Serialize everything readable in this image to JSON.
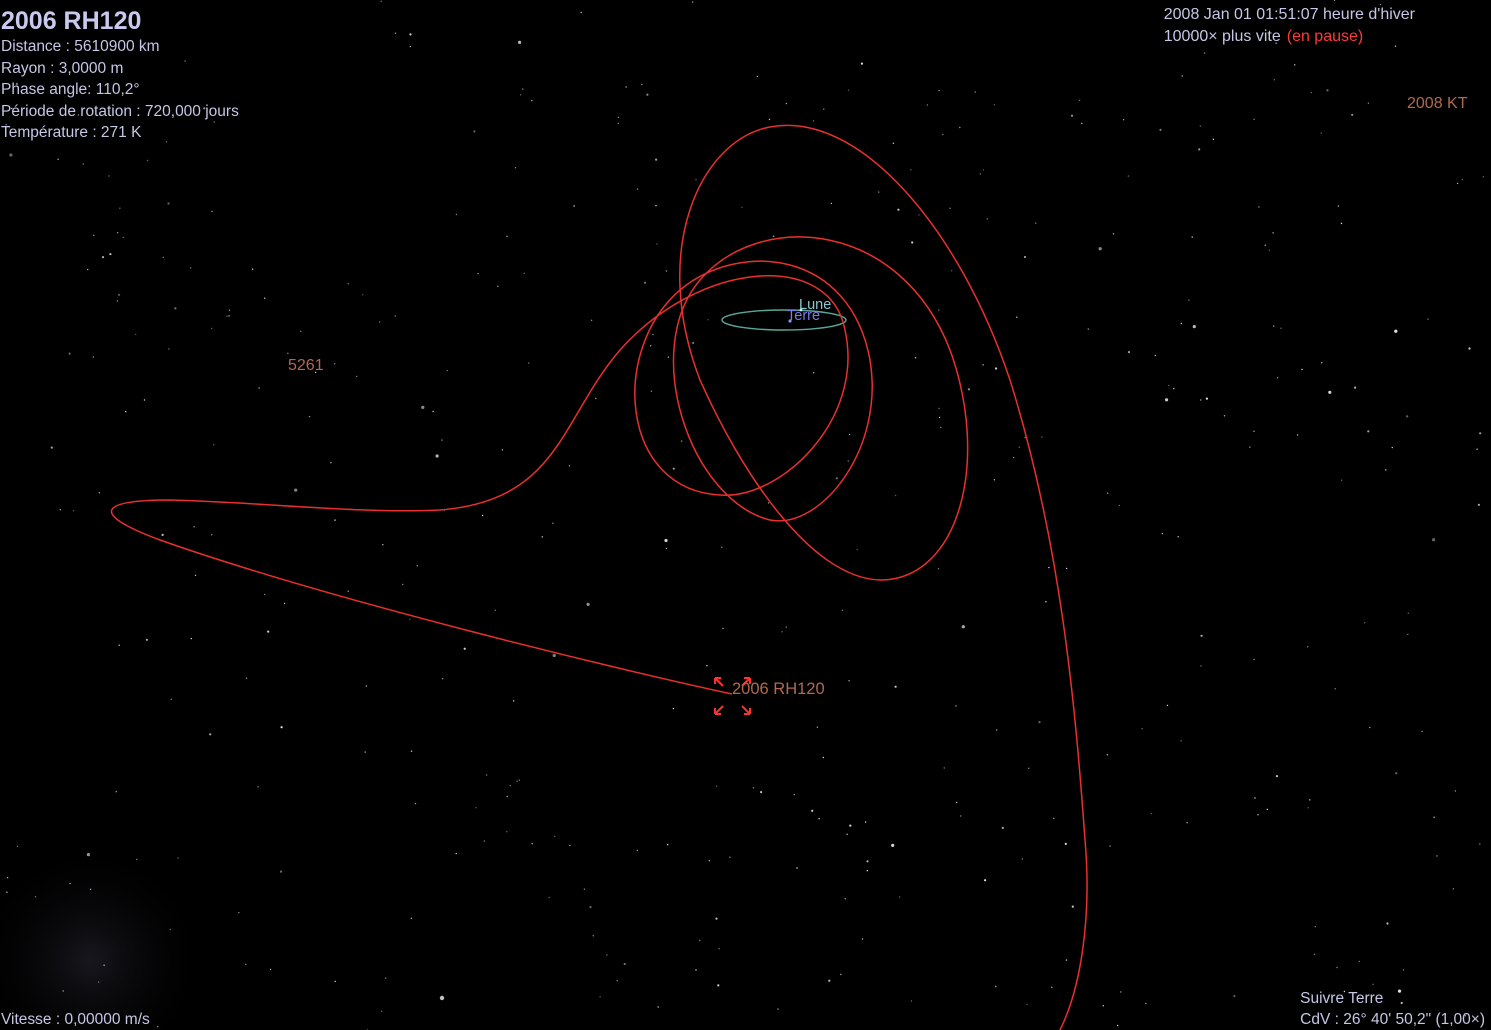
{
  "selection": {
    "name": "2006 RH120",
    "distance": "Distance : 5610900 km",
    "radius": "Rayon : 3,0000 m",
    "phase_angle": "Phase angle: 110,2°",
    "rotation_period": "Période de rotation : 720,000 jours",
    "temperature": "Température : 271 K"
  },
  "time": {
    "datetime": "2008 Jan 01 01:51:07 heure d'hiver",
    "rate": "10000× plus vite",
    "status": "(en pause)"
  },
  "status_bar": {
    "speed": "Vitesse : 0,00000 m/s",
    "follow": "Suivre Terre",
    "fov": "CdV : 26° 40' 50,2\" (1,00×)"
  },
  "labels": {
    "object_2008kt": "2008 KT",
    "object_5261": "5261",
    "moon": "Lune",
    "earth": "Terre",
    "selected_target": "2006 RH120"
  },
  "colors": {
    "background": "#000000",
    "trajectory": "#e8302e",
    "moon_orbit": "#5aa89a",
    "hud_text": "#c6c6e6",
    "paused_text": "#ff3a3a",
    "asteroid_label": "#b06a4e",
    "selection_marker": "#ff3030"
  },
  "icons": {
    "selection_marker": "target-brackets-icon"
  }
}
